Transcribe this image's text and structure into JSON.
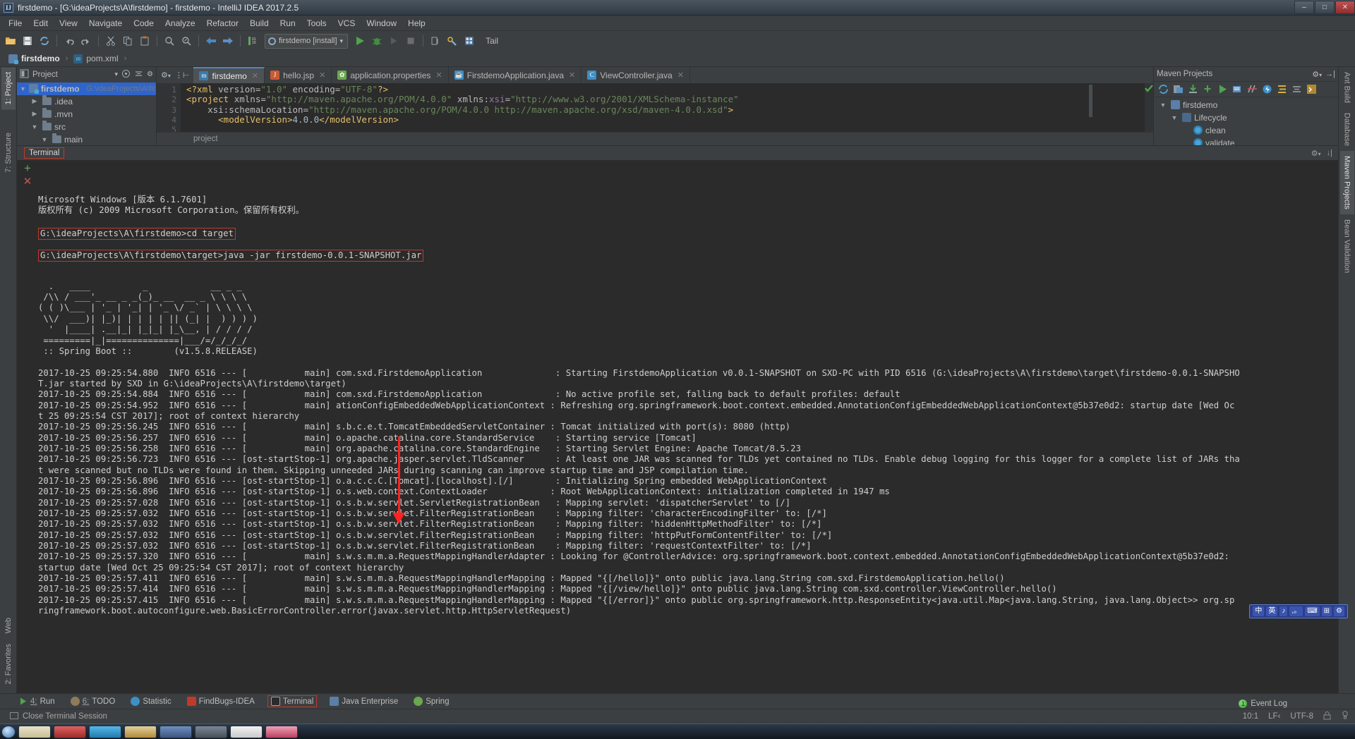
{
  "window": {
    "title": "firstdemo - [G:\\ideaProjects\\A\\firstdemo] - firstdemo - IntelliJ IDEA 2017.2.5",
    "logo_text": "IJ",
    "minimize": "–",
    "maximize": "□",
    "close": "✕"
  },
  "menu": {
    "items": [
      "File",
      "Edit",
      "View",
      "Navigate",
      "Code",
      "Analyze",
      "Refactor",
      "Build",
      "Run",
      "Tools",
      "VCS",
      "Window",
      "Help"
    ]
  },
  "toolbar": {
    "icons": [
      "open-folder-icon",
      "save-all-icon",
      "sync-icon",
      "undo-icon",
      "redo-icon",
      "cut-icon",
      "copy-icon",
      "paste-icon",
      "find-icon",
      "replace-icon",
      "back-icon",
      "forward-icon",
      "toggle-bookmark-icon"
    ],
    "run_config": "firstdemo [install]",
    "run_config_caret": "▾",
    "run": "▶",
    "debug": "debug-icon",
    "rerun": "▷",
    "stop": "■",
    "more": "more-icon",
    "settings": "settings-icon",
    "structure": "structure-icon",
    "tail_label": "Tail"
  },
  "navbar": {
    "crumbs": [
      "firstdemo",
      "pom.xml"
    ],
    "separator": "›"
  },
  "left_stripe": {
    "project_tab": "1: Project",
    "structure_tab": "7: Structure",
    "web_tab": "Web",
    "favorites_tab": "2: Favorites"
  },
  "right_stripe": {
    "ant_tab": "Ant Build",
    "database_tab": "Database",
    "maven_tab": "Maven Projects",
    "bean_tab": "Bean Validation"
  },
  "project_panel": {
    "title": "Project",
    "caret": "▾",
    "collapse_icon": "collapse-all-icon",
    "target_icon": "scroll-from-source-icon",
    "settings_icon": "gear-icon",
    "hide_icon": "hide-icon",
    "tree": [
      {
        "label": "firstdemo",
        "path": "G:\\ideaProjects\\A\\firstd",
        "depth": 0,
        "arrow": "▼",
        "icon": "module",
        "selected": true
      },
      {
        "label": ".idea",
        "path": "",
        "depth": 1,
        "arrow": "▶",
        "icon": "folder",
        "selected": false
      },
      {
        "label": ".mvn",
        "path": "",
        "depth": 1,
        "arrow": "▶",
        "icon": "folder",
        "selected": false
      },
      {
        "label": "src",
        "path": "",
        "depth": 1,
        "arrow": "▼",
        "icon": "folder",
        "selected": false
      },
      {
        "label": "main",
        "path": "",
        "depth": 2,
        "arrow": "▼",
        "icon": "folder",
        "selected": false
      }
    ]
  },
  "editor": {
    "tab_control_gear": "gear-icon",
    "tab_control_split": "split-icon",
    "tabs": [
      {
        "label": "firstdemo",
        "icon_text": "m",
        "icon_color": "#3c7ba8",
        "selected": true
      },
      {
        "label": "hello.jsp",
        "icon_text": "J",
        "icon_color": "#c75b34",
        "selected": false
      },
      {
        "label": "application.properties",
        "icon_text": "✿",
        "icon_color": "#6aa84f",
        "selected": false
      },
      {
        "label": "FirstdemoApplication.java",
        "icon_text": "☕",
        "icon_color": "#3d8fc4",
        "selected": false
      },
      {
        "label": "ViewController.java",
        "icon_text": "C",
        "icon_color": "#3d8fc4",
        "selected": false
      }
    ],
    "close_glyph": "✕",
    "line_numbers": [
      "1",
      "2",
      "3",
      "4",
      "5"
    ],
    "code_lines": [
      {
        "segments": [
          {
            "t": "<?xml ",
            "c": "tag"
          },
          {
            "t": "version=",
            "c": "attr"
          },
          {
            "t": "\"1.0\"",
            "c": "str"
          },
          {
            "t": " encoding=",
            "c": "attr"
          },
          {
            "t": "\"UTF-8\"",
            "c": "str"
          },
          {
            "t": "?>",
            "c": "tag"
          }
        ]
      },
      {
        "segments": [
          {
            "t": "<project ",
            "c": "tag"
          },
          {
            "t": "xmlns=",
            "c": "attr"
          },
          {
            "t": "\"http://maven.apache.org/POM/4.0.0\"",
            "c": "str"
          },
          {
            "t": " xmlns:",
            "c": "attr"
          },
          {
            "t": "xsi",
            "c": "ns"
          },
          {
            "t": "=",
            "c": "attr"
          },
          {
            "t": "\"http://www.w3.org/2001/XMLSchema-instance\"",
            "c": "str"
          }
        ]
      },
      {
        "segments": [
          {
            "t": "    xsi:schemaLocation=",
            "c": "attr"
          },
          {
            "t": "\"http://maven.apache.org/POM/4.0.0 http://maven.apache.org/xsd/maven-4.0.0.xsd\"",
            "c": "str"
          },
          {
            "t": ">",
            "c": "tag"
          }
        ]
      },
      {
        "segments": [
          {
            "t": "      <modelVersion>",
            "c": "tag"
          },
          {
            "t": "4.0.0",
            "c": "punc"
          },
          {
            "t": "</modelVersion>",
            "c": "tag"
          }
        ]
      },
      {
        "segments": []
      }
    ],
    "breadcrumb": "project"
  },
  "maven_panel": {
    "title": "Maven Projects",
    "gear_icon": "gear-icon",
    "hide_icon": "hide-icon",
    "toolbar_icons": [
      "reimport-icon",
      "generate-sources-icon",
      "download-sources-icon",
      "add-maven-project-icon",
      "run-maven-build-icon",
      "toggle-offline-icon",
      "skip-tests-icon",
      "execute-goal-icon",
      "show-dependencies-icon",
      "collapse-all-icon",
      "maven-settings-icon"
    ],
    "tree": [
      {
        "label": "firstdemo",
        "depth": 0,
        "arrow": "▼",
        "icon": "maven-module-icon"
      },
      {
        "label": "Lifecycle",
        "depth": 1,
        "arrow": "▼",
        "icon": "lifecycle-icon"
      },
      {
        "label": "clean",
        "depth": 2,
        "arrow": "",
        "icon": "goal-icon"
      },
      {
        "label": "validate",
        "depth": 2,
        "arrow": "",
        "icon": "goal-icon"
      }
    ]
  },
  "terminal": {
    "tab_label": "Terminal",
    "new_session_icon": "+",
    "close_session_icon": "✕",
    "gear_icon": "gear-icon",
    "hide_icon": "hide-icon",
    "lines": [
      {
        "text": "Microsoft Windows [版本 6.1.7601]",
        "boxed": false
      },
      {
        "text": "版权所有 (c) 2009 Microsoft Corporation。保留所有权利。",
        "boxed": false
      },
      {
        "text": "",
        "boxed": false
      },
      {
        "text": "G:\\ideaProjects\\A\\firstdemo>cd target",
        "boxed": true
      },
      {
        "text": "",
        "boxed": false
      },
      {
        "text": "G:\\ideaProjects\\A\\firstdemo\\target>java -jar firstdemo-0.0.1-SNAPSHOT.jar",
        "boxed": true
      },
      {
        "text": "",
        "boxed": false
      },
      {
        "text": "",
        "boxed": false
      },
      {
        "text": "  .   ____          _            __ _ _",
        "boxed": false
      },
      {
        "text": " /\\\\ / ___'_ __ _ _(_)_ __  __ _ \\ \\ \\ \\",
        "boxed": false
      },
      {
        "text": "( ( )\\___ | '_ | '_| | '_ \\/ _` | \\ \\ \\ \\",
        "boxed": false
      },
      {
        "text": " \\\\/  ___)| |_)| | | | | || (_| |  ) ) ) )",
        "boxed": false
      },
      {
        "text": "  '  |____| .__|_| |_|_| |_\\__, | / / / /",
        "boxed": false
      },
      {
        "text": " =========|_|==============|___/=/_/_/_/",
        "boxed": false
      },
      {
        "text": " :: Spring Boot ::        (v1.5.8.RELEASE)",
        "boxed": false
      },
      {
        "text": "",
        "boxed": false
      },
      {
        "text": "2017-10-25 09:25:54.880  INFO 6516 --- [           main] com.sxd.FirstdemoApplication              : Starting FirstdemoApplication v0.0.1-SNAPSHOT on SXD-PC with PID 6516 (G:\\ideaProjects\\A\\firstdemo\\target\\firstdemo-0.0.1-SNAPSHO",
        "boxed": false
      },
      {
        "text": "T.jar started by SXD in G:\\ideaProjects\\A\\firstdemo\\target)",
        "boxed": false
      },
      {
        "text": "2017-10-25 09:25:54.884  INFO 6516 --- [           main] com.sxd.FirstdemoApplication              : No active profile set, falling back to default profiles: default",
        "boxed": false
      },
      {
        "text": "2017-10-25 09:25:54.952  INFO 6516 --- [           main] ationConfigEmbeddedWebApplicationContext : Refreshing org.springframework.boot.context.embedded.AnnotationConfigEmbeddedWebApplicationContext@5b37e0d2: startup date [Wed Oc",
        "boxed": false
      },
      {
        "text": "t 25 09:25:54 CST 2017]; root of context hierarchy",
        "boxed": false
      },
      {
        "text": "2017-10-25 09:25:56.245  INFO 6516 --- [           main] s.b.c.e.t.TomcatEmbeddedServletContainer : Tomcat initialized with port(s): 8080 (http)",
        "boxed": false
      },
      {
        "text": "2017-10-25 09:25:56.257  INFO 6516 --- [           main] o.apache.catalina.core.StandardService    : Starting service [Tomcat]",
        "boxed": false
      },
      {
        "text": "2017-10-25 09:25:56.258  INFO 6516 --- [           main] org.apache.catalina.core.StandardEngine   : Starting Servlet Engine: Apache Tomcat/8.5.23",
        "boxed": false
      },
      {
        "text": "2017-10-25 09:25:56.723  INFO 6516 --- [ost-startStop-1] org.apache.jasper.servlet.TldScanner      : At least one JAR was scanned for TLDs yet contained no TLDs. Enable debug logging for this logger for a complete list of JARs tha",
        "boxed": false
      },
      {
        "text": "t were scanned but no TLDs were found in them. Skipping unneeded JARs during scanning can improve startup time and JSP compilation time.",
        "boxed": false
      },
      {
        "text": "2017-10-25 09:25:56.896  INFO 6516 --- [ost-startStop-1] o.a.c.c.C.[Tomcat].[localhost].[/]        : Initializing Spring embedded WebApplicationContext",
        "boxed": false
      },
      {
        "text": "2017-10-25 09:25:56.896  INFO 6516 --- [ost-startStop-1] o.s.web.context.ContextLoader            : Root WebApplicationContext: initialization completed in 1947 ms",
        "boxed": false
      },
      {
        "text": "2017-10-25 09:25:57.028  INFO 6516 --- [ost-startStop-1] o.s.b.w.servlet.ServletRegistrationBean   : Mapping servlet: 'dispatcherServlet' to [/]",
        "boxed": false
      },
      {
        "text": "2017-10-25 09:25:57.032  INFO 6516 --- [ost-startStop-1] o.s.b.w.servlet.FilterRegistrationBean    : Mapping filter: 'characterEncodingFilter' to: [/*]",
        "boxed": false
      },
      {
        "text": "2017-10-25 09:25:57.032  INFO 6516 --- [ost-startStop-1] o.s.b.w.servlet.FilterRegistrationBean    : Mapping filter: 'hiddenHttpMethodFilter' to: [/*]",
        "boxed": false
      },
      {
        "text": "2017-10-25 09:25:57.032  INFO 6516 --- [ost-startStop-1] o.s.b.w.servlet.FilterRegistrationBean    : Mapping filter: 'httpPutFormContentFilter' to: [/*]",
        "boxed": false
      },
      {
        "text": "2017-10-25 09:25:57.032  INFO 6516 --- [ost-startStop-1] o.s.b.w.servlet.FilterRegistrationBean    : Mapping filter: 'requestContextFilter' to: [/*]",
        "boxed": false
      },
      {
        "text": "2017-10-25 09:25:57.320  INFO 6516 --- [           main] s.w.s.m.m.a.RequestMappingHandlerAdapter : Looking for @ControllerAdvice: org.springframework.boot.context.embedded.AnnotationConfigEmbeddedWebApplicationContext@5b37e0d2:",
        "boxed": false
      },
      {
        "text": "startup date [Wed Oct 25 09:25:54 CST 2017]; root of context hierarchy",
        "boxed": false
      },
      {
        "text": "2017-10-25 09:25:57.411  INFO 6516 --- [           main] s.w.s.m.m.a.RequestMappingHandlerMapping : Mapped \"{[/hello]}\" onto public java.lang.String com.sxd.FirstdemoApplication.hello()",
        "boxed": false
      },
      {
        "text": "2017-10-25 09:25:57.414  INFO 6516 --- [           main] s.w.s.m.m.a.RequestMappingHandlerMapping : Mapped \"{[/view/hello]}\" onto public java.lang.String com.sxd.controller.ViewController.hello()",
        "boxed": false
      },
      {
        "text": "2017-10-25 09:25:57.415  INFO 6516 --- [           main] s.w.s.m.m.a.RequestMappingHandlerMapping : Mapped \"{[/error]}\" onto public org.springframework.http.ResponseEntity<java.util.Map<java.lang.String, java.lang.Object>> org.sp",
        "boxed": false
      },
      {
        "text": "ringframework.boot.autoconfigure.web.BasicErrorController.error(javax.servlet.http.HttpServletRequest)",
        "boxed": false
      }
    ]
  },
  "ime_bar": {
    "items": [
      "中",
      "英",
      "♪",
      ",。",
      "⌨",
      "⊞",
      "⚙"
    ]
  },
  "bottom_tabs": [
    {
      "num": "4",
      "label": "Run",
      "icon": "run-icon",
      "selected": false
    },
    {
      "num": "6",
      "label": "TODO",
      "icon": "todo-icon",
      "selected": false
    },
    {
      "num": "",
      "label": "Statistic",
      "icon": "statistic-icon",
      "selected": false
    },
    {
      "num": "",
      "label": "FindBugs-IDEA",
      "icon": "findbugs-icon",
      "selected": false
    },
    {
      "num": "",
      "label": "Terminal",
      "icon": "terminal-icon",
      "selected": true
    },
    {
      "num": "",
      "label": "Java Enterprise",
      "icon": "java-enterprise-icon",
      "selected": false
    },
    {
      "num": "",
      "label": "Spring",
      "icon": "spring-icon",
      "selected": false
    }
  ],
  "status_bar": {
    "message": "Close Terminal Session",
    "message_icon": "terminal-small-icon",
    "caret_position": "10:1",
    "line_separator": "LF‹",
    "encoding": "UTF-8",
    "lock_icon": "lock-icon",
    "inspection_icon": "inspection-icon",
    "event_log": "Event Log",
    "event_log_badge": "1"
  }
}
